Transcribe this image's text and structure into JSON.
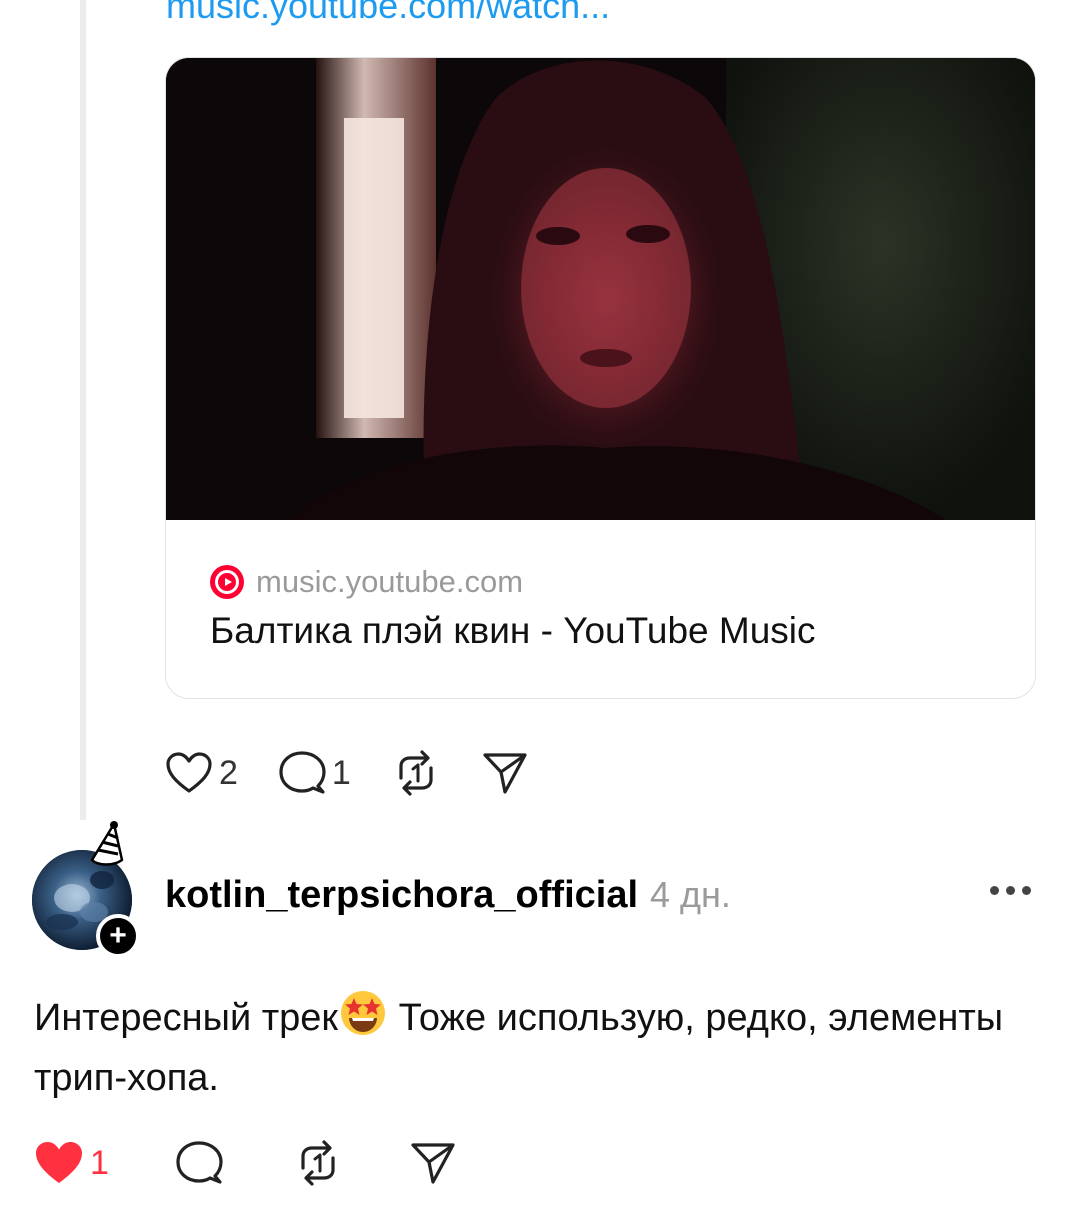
{
  "post_link": {
    "text": "music.youtube.com/watch..."
  },
  "link_card": {
    "domain": "music.youtube.com",
    "title": "Балтика плэй квин - YouTube Music",
    "image_icon": "video-thumbnail"
  },
  "parent_actions": {
    "like_count": "2",
    "reply_count": "1",
    "like_icon": "heart-outline-icon",
    "reply_icon": "speech-bubble-icon",
    "repost_icon": "repost-icon",
    "share_icon": "send-icon"
  },
  "reply": {
    "username": "kotlin_terpsichora_official",
    "timestamp": "4 дн.",
    "text_before_emoji": "Интересный трек",
    "emoji": "star-struck-emoji",
    "text_after_emoji": " Тоже использую, редко, элементы трип-хопа.",
    "follow_badge": "+",
    "like_count": "1",
    "like_icon": "heart-filled-icon",
    "like_color": "#ff3040"
  },
  "colors": {
    "link": "#1d9bf0",
    "muted": "#9a9a9a",
    "youtube_red": "#ff0033"
  }
}
